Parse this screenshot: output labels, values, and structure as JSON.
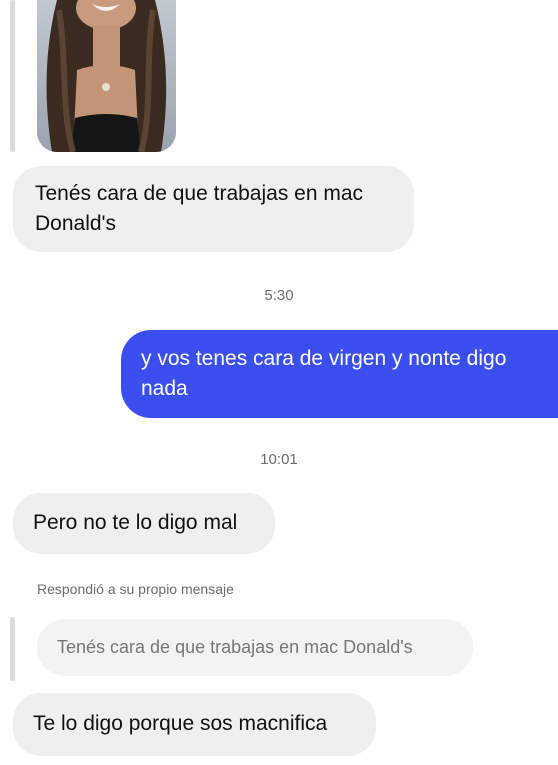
{
  "conversation": {
    "photo": {
      "icon": "photo-thumbnail"
    },
    "messages": [
      {
        "text": "Tenés cara de que trabajas en mac Donald's",
        "direction": "received"
      },
      {
        "text": "y vos tenes cara de virgen y nonte digo nada",
        "direction": "sent"
      },
      {
        "text": "Pero no te lo digo mal",
        "direction": "received"
      },
      {
        "text": "Te lo digo porque sos macnifica",
        "direction": "received"
      }
    ],
    "timestamps": [
      "5:30",
      "10:01"
    ],
    "reply": {
      "note": "Respondió a su propio mensaje",
      "quoted": "Tenés cara de que trabajas en mac Donald's"
    }
  },
  "colors": {
    "sent_bubble": "#3b4ef0",
    "received_bubble": "#efefef",
    "background": "#ffffff"
  }
}
